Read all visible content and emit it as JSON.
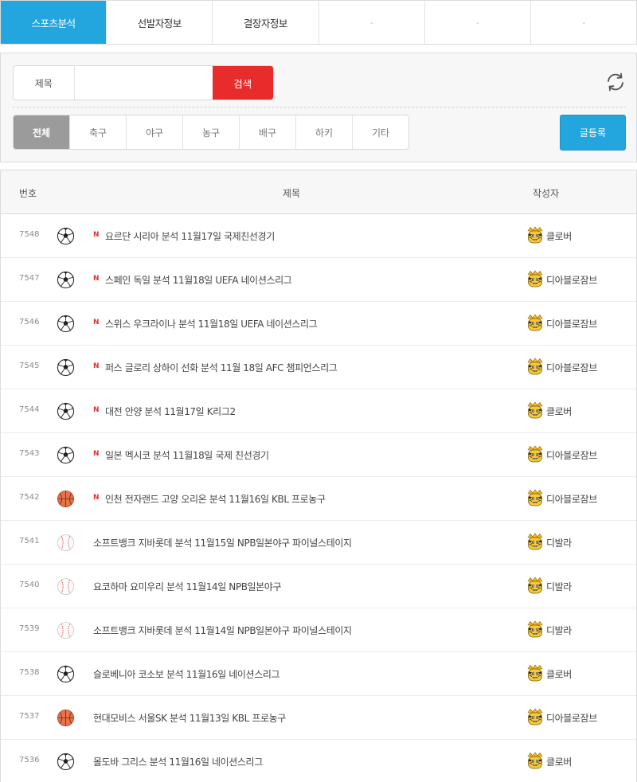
{
  "tabs": [
    {
      "label": "스포츠분석",
      "active": true
    },
    {
      "label": "선발자정보",
      "active": false
    },
    {
      "label": "결장자정보",
      "active": false
    },
    {
      "label": "-",
      "active": false
    },
    {
      "label": "-",
      "active": false
    },
    {
      "label": "-",
      "active": false
    }
  ],
  "search": {
    "label": "제목",
    "value": "",
    "placeholder": "",
    "button": "검색"
  },
  "refresh_icon": "refresh-icon",
  "categories": [
    {
      "label": "전체",
      "active": true
    },
    {
      "label": "축구",
      "active": false
    },
    {
      "label": "야구",
      "active": false
    },
    {
      "label": "농구",
      "active": false
    },
    {
      "label": "배구",
      "active": false
    },
    {
      "label": "하키",
      "active": false
    },
    {
      "label": "기타",
      "active": false
    }
  ],
  "write_button": "글등록",
  "columns": {
    "number": "번호",
    "title": "제목",
    "author": "작성자"
  },
  "new_badge": "N",
  "rows": [
    {
      "number": "7548",
      "sport": "soccer",
      "is_new": true,
      "title": "요르단 시리아 분석 11월17일 국제친선경기",
      "author": "클로버"
    },
    {
      "number": "7547",
      "sport": "soccer",
      "is_new": true,
      "title": "스페인 독일 분석 11월18일 UEFA 네이션스리그",
      "author": "디아블로잠브"
    },
    {
      "number": "7546",
      "sport": "soccer",
      "is_new": true,
      "title": "스위스 우크라이나 분석 11월18일 UEFA 네이션스리그",
      "author": "디아블로잠브"
    },
    {
      "number": "7545",
      "sport": "soccer",
      "is_new": true,
      "title": "퍼스 글로리 상하이 선화 분석 11월 18일 AFC 챔피언스리그",
      "author": "디아블로잠브"
    },
    {
      "number": "7544",
      "sport": "soccer",
      "is_new": true,
      "title": "대전 안양 분석 11월17일 K리그2",
      "author": "클로버"
    },
    {
      "number": "7543",
      "sport": "soccer",
      "is_new": true,
      "title": "일본 멕시코 분석 11월18일 국제 친선경기",
      "author": "디아블로잠브"
    },
    {
      "number": "7542",
      "sport": "basketball",
      "is_new": true,
      "title": "인천 전자랜드 고양 오리온 분석 11월16일 KBL 프로농구",
      "author": "디아블로잠브"
    },
    {
      "number": "7541",
      "sport": "baseball",
      "is_new": false,
      "title": "소프트뱅크 지바롯데 분석 11월15일 NPB일본야구 파이널스테이지",
      "author": "디발라"
    },
    {
      "number": "7540",
      "sport": "baseball",
      "is_new": false,
      "title": "요코하마 요미우리 분석 11월14일 NPB일본야구",
      "author": "디발라"
    },
    {
      "number": "7539",
      "sport": "baseball",
      "is_new": false,
      "title": "소프트뱅크 지바롯데 분석 11월14일 NPB일본야구 파이널스테이지",
      "author": "디발라"
    },
    {
      "number": "7538",
      "sport": "soccer",
      "is_new": false,
      "title": "슬로베니아 코소보 분석 11월16일 네이션스리그",
      "author": "클로버"
    },
    {
      "number": "7537",
      "sport": "basketball",
      "is_new": false,
      "title": "현대모비스 서울SK 분석 11월13일 KBL 프로농구",
      "author": "디아블로잠브"
    },
    {
      "number": "7536",
      "sport": "soccer",
      "is_new": false,
      "title": "몰도바 그리스 분석 11월16일 네이션스리그",
      "author": "클로버"
    }
  ],
  "colors": {
    "accent_blue": "#23a6de",
    "search_red": "#e82b2b",
    "new_red": "#e53030",
    "category_active": "#9b9b9b"
  }
}
